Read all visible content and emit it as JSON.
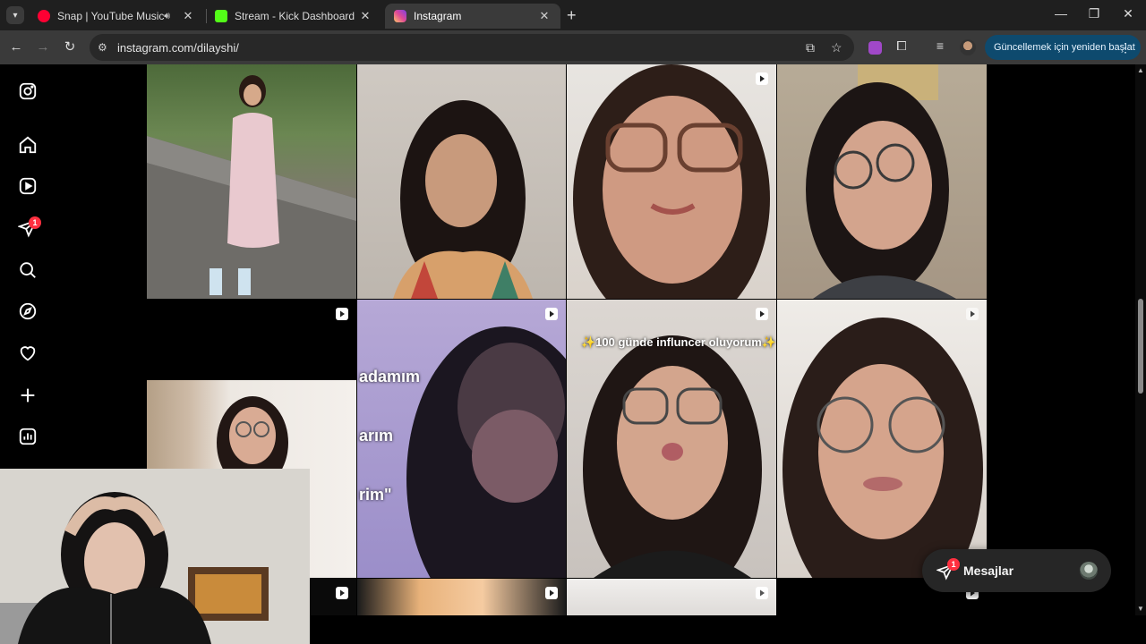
{
  "browser": {
    "tabs": [
      {
        "title": "Snap | YouTube Music",
        "favicon": "youtube-music-icon",
        "audio": true,
        "active": false
      },
      {
        "title": "Stream - Kick Dashboard",
        "favicon": "kick-icon",
        "audio": false,
        "active": false
      },
      {
        "title": "Instagram",
        "favicon": "instagram-icon",
        "audio": false,
        "active": true
      }
    ],
    "url": "instagram.com/dilayshi/",
    "update_button": "Güncellemek için yeniden başlat",
    "colors": {
      "tab_bar": "#1f1f1f",
      "toolbar": "#3a3a3a",
      "update_button": "#0e4a6e"
    }
  },
  "instagram": {
    "nav": [
      {
        "name": "instagram-logo-icon"
      },
      {
        "name": "home-icon"
      },
      {
        "name": "reels-icon"
      },
      {
        "name": "messages-icon",
        "badge": "1"
      },
      {
        "name": "search-icon"
      },
      {
        "name": "explore-icon"
      },
      {
        "name": "notifications-icon"
      },
      {
        "name": "create-icon"
      },
      {
        "name": "dashboard-icon"
      }
    ],
    "posts": [
      {
        "type": "photo",
        "desc": "woman sitting on stone bridge wall"
      },
      {
        "type": "reel",
        "desc": "woman talking indoors"
      },
      {
        "type": "reel",
        "desc": "woman with glasses selfie"
      },
      {
        "type": "reel",
        "desc": "woman with glasses hand on head"
      },
      {
        "type": "reel",
        "desc": "woman smiling with glasses"
      },
      {
        "type": "reel",
        "caption_left": "adamım",
        "caption_mid": "arım",
        "caption_bot": "rim\"",
        "desc": "chimpanzee meme"
      },
      {
        "type": "reel",
        "caption": "✨100 günde influncer oluyorum✨",
        "desc": "woman with glasses talking"
      },
      {
        "type": "reel",
        "desc": "woman with round glasses"
      }
    ],
    "messages": {
      "label": "Mesajlar",
      "badge": "1"
    }
  }
}
